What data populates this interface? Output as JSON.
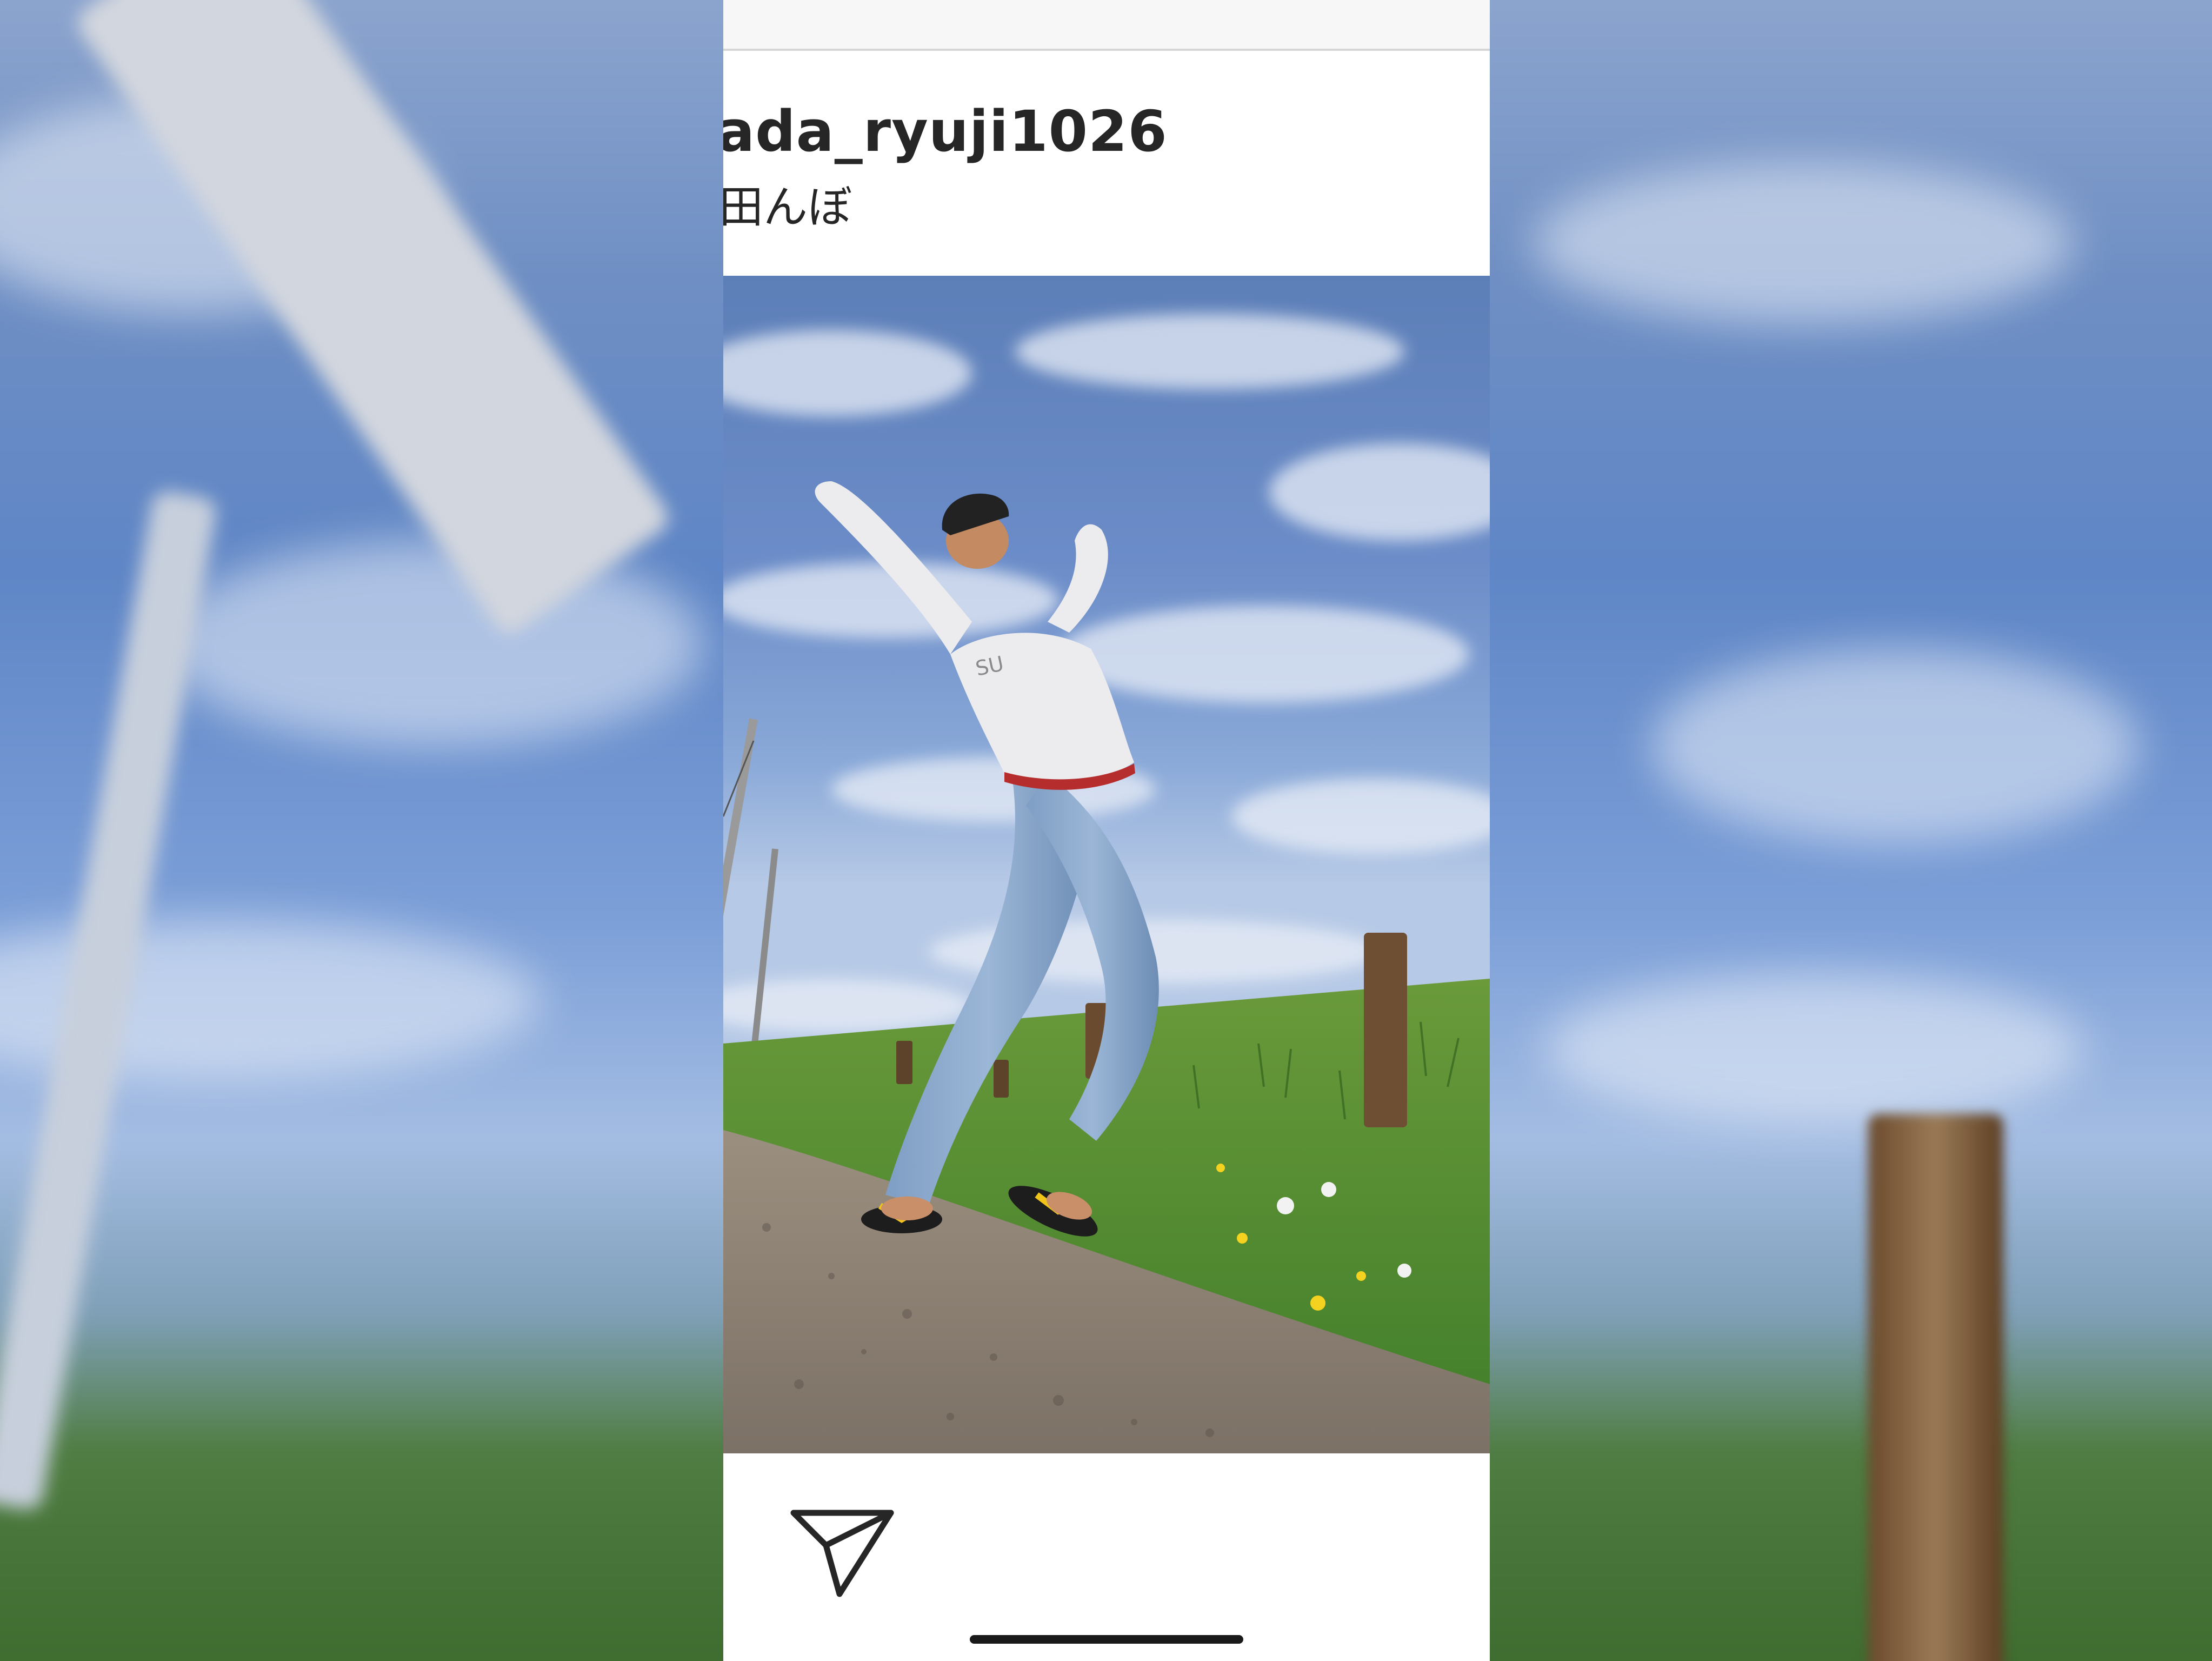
{
  "post": {
    "username": "ada_ryuji1026",
    "location": "田んぼ"
  },
  "photo": {
    "shirt_text": "SU"
  },
  "icons": {
    "share": "paper-plane-icon"
  },
  "colors": {
    "text": "#262626",
    "background": "#ffffff",
    "home_indicator": "#1a1a1a"
  }
}
